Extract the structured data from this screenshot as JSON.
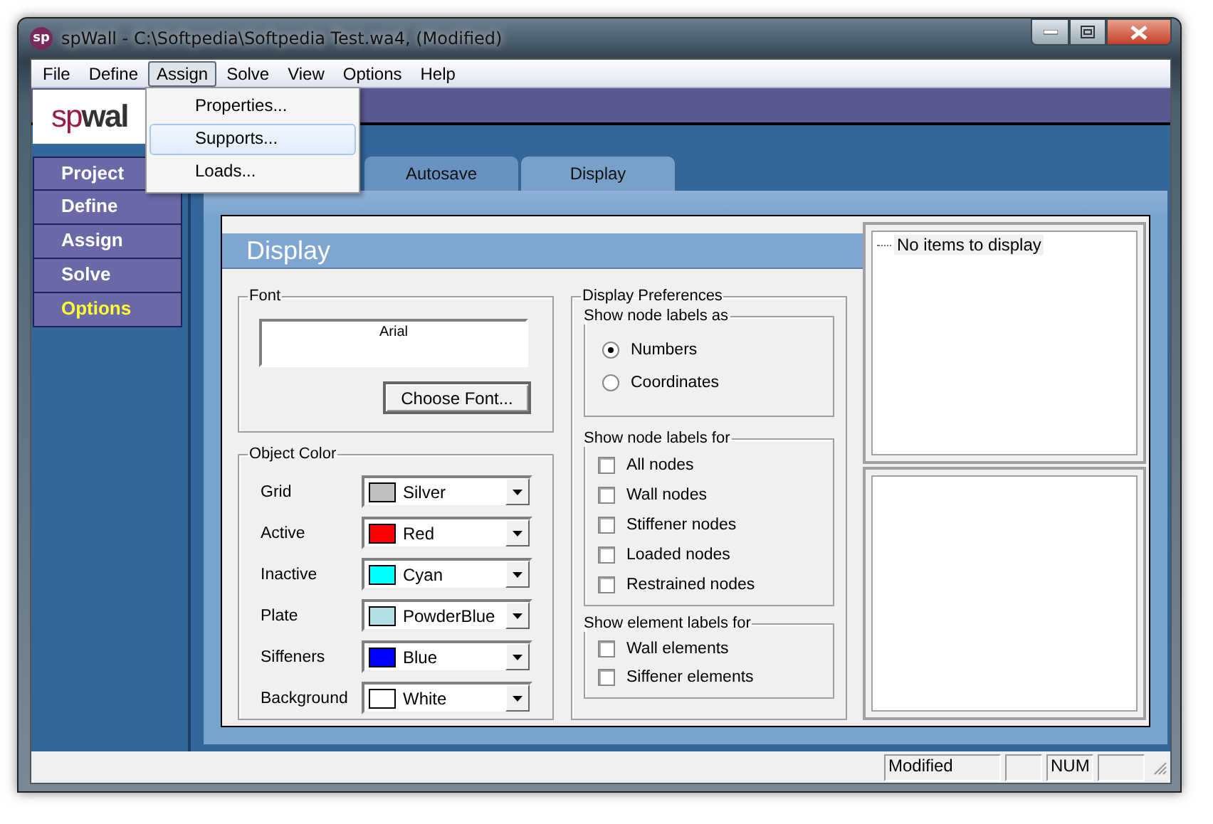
{
  "window": {
    "title": "spWall - C:\\Softpedia\\Softpedia Test.wa4, (Modified)",
    "app_icon": "sp"
  },
  "menu_bar": [
    {
      "label": "File",
      "selected": false
    },
    {
      "label": "Define",
      "selected": false
    },
    {
      "label": "Assign",
      "selected": true
    },
    {
      "label": "Solve",
      "selected": false
    },
    {
      "label": "View",
      "selected": false
    },
    {
      "label": "Options",
      "selected": false
    },
    {
      "label": "Help",
      "selected": false
    }
  ],
  "open_menu": [
    {
      "label": "Properties...",
      "selected": false
    },
    {
      "label": "Supports...",
      "selected": true
    },
    {
      "label": "Loads...",
      "selected": false
    }
  ],
  "logo": {
    "prefix": "sp",
    "name": "wal"
  },
  "sidebar": [
    {
      "label": "Project",
      "selected": false
    },
    {
      "label": "Define",
      "selected": false
    },
    {
      "label": "Assign",
      "selected": false
    },
    {
      "label": "Solve",
      "selected": false
    },
    {
      "label": "Options",
      "selected": true
    }
  ],
  "tabs": [
    {
      "label": "Autosave",
      "selected": false
    },
    {
      "label": "Display",
      "selected": true
    }
  ],
  "page_title": "Display",
  "font_group": {
    "title": "Font",
    "sample": "Arial",
    "button": "Choose Font..."
  },
  "object_color": {
    "title": "Object Color",
    "rows": [
      {
        "label": "Grid",
        "value": "Silver",
        "color": "#c0c0c0"
      },
      {
        "label": "Active",
        "value": "Red",
        "color": "#ff0000"
      },
      {
        "label": "Inactive",
        "value": "Cyan",
        "color": "#00ffff"
      },
      {
        "label": "Plate",
        "value": "PowderBlue",
        "color": "#b0e0e6"
      },
      {
        "label": "Siffeners",
        "value": "Blue",
        "color": "#0000ff"
      },
      {
        "label": "Background",
        "value": "White",
        "color": "#ffffff"
      }
    ]
  },
  "display_preferences": {
    "title": "Display Preferences",
    "node_labels_as": {
      "title": "Show node labels as",
      "options": [
        {
          "label": "Numbers",
          "selected": true
        },
        {
          "label": "Coordinates",
          "selected": false
        }
      ]
    },
    "node_labels_for": {
      "title": "Show node labels for",
      "options": [
        {
          "label": "All nodes",
          "checked": false
        },
        {
          "label": "Wall nodes",
          "checked": false
        },
        {
          "label": "Stiffener nodes",
          "checked": false
        },
        {
          "label": "Loaded nodes",
          "checked": false
        },
        {
          "label": "Restrained nodes",
          "checked": false
        }
      ]
    },
    "element_labels_for": {
      "title": "Show element labels for",
      "options": [
        {
          "label": "Wall elements",
          "checked": false
        },
        {
          "label": "Siffener elements",
          "checked": false
        }
      ]
    }
  },
  "tree": {
    "items": [
      "No items to display"
    ]
  },
  "status_bar": [
    "Modified",
    "NUM"
  ]
}
